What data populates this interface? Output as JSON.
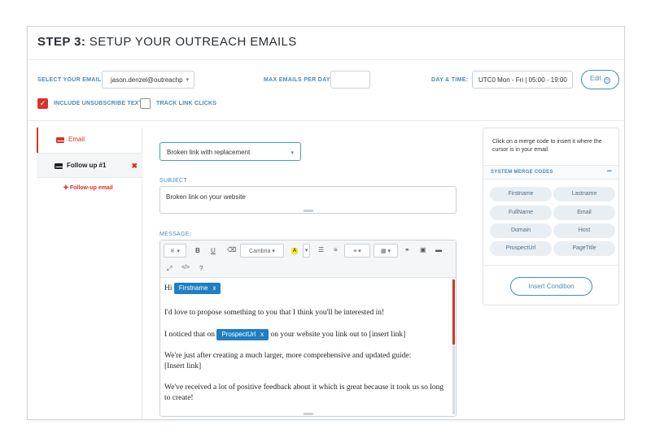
{
  "header": {
    "step_label": "STEP 3:",
    "title": "SETUP YOUR OUTREACH EMAILS"
  },
  "settings": {
    "select_email_label": "SELECT YOUR EMAIL:",
    "selected_email": "jason.denzel@outreachp",
    "max_emails_label": "MAX EMAILS PER DAY:",
    "max_emails_value": "",
    "day_time_label": "DAY & TIME:",
    "day_time_value": "UTC0  Mon - Fri | 05:00 - 19:00",
    "edit_label": "Edit",
    "include_unsubscribe_label": "INCLUDE UNSUBSCRIBE TEXT",
    "include_unsubscribe_checked": true,
    "track_links_label": "TRACK LINK CLICKS",
    "track_links_checked": false
  },
  "tabs": [
    {
      "label": "Email",
      "active": true
    },
    {
      "label": "Follow up #1",
      "active": false
    }
  ],
  "add_followup_label": "Follow-up email",
  "template": {
    "selected": "Broken link with replacement"
  },
  "subject": {
    "label": "SUBJECT",
    "value": "Broken link on your website"
  },
  "message": {
    "label": "MESSAGE:",
    "toolbar": {
      "font": "Cambria",
      "bold": "B",
      "underline": "U",
      "code": "</>",
      "help": "?"
    },
    "greeting": "Hi",
    "tag_firstname": "Firstname",
    "line1": "I'd love to propose something to you that I think you'll be interested in!",
    "line2_before": "I noticed that on",
    "tag_prospecturl": "ProspectUrl",
    "line2_after": "on your website you link out to [insert link]",
    "line3a": "We're just after creating a much larger, more comprehensive and updated guide:",
    "line3b": "[Insert link]",
    "line4": "We've received a lot of positive feedback about it which is great because it took us so long to create!",
    "tag_close": "x"
  },
  "merge_panel": {
    "hint": "Click on a merge code to insert it where the cursor is in your email",
    "section_title": "SYSTEM MERGE CODES",
    "collapse_symbol": "−",
    "codes": [
      "Firstname",
      "Lastname",
      "FullName",
      "Email",
      "Domain",
      "Host",
      "ProspectUrl",
      "PageTitle"
    ],
    "insert_condition_label": "Insert Condition"
  },
  "colors": {
    "accent_red": "#d9322a",
    "accent_blue": "#4a8ab8",
    "tag_blue": "#1e7fc3",
    "template_border": "#3fa99b"
  }
}
